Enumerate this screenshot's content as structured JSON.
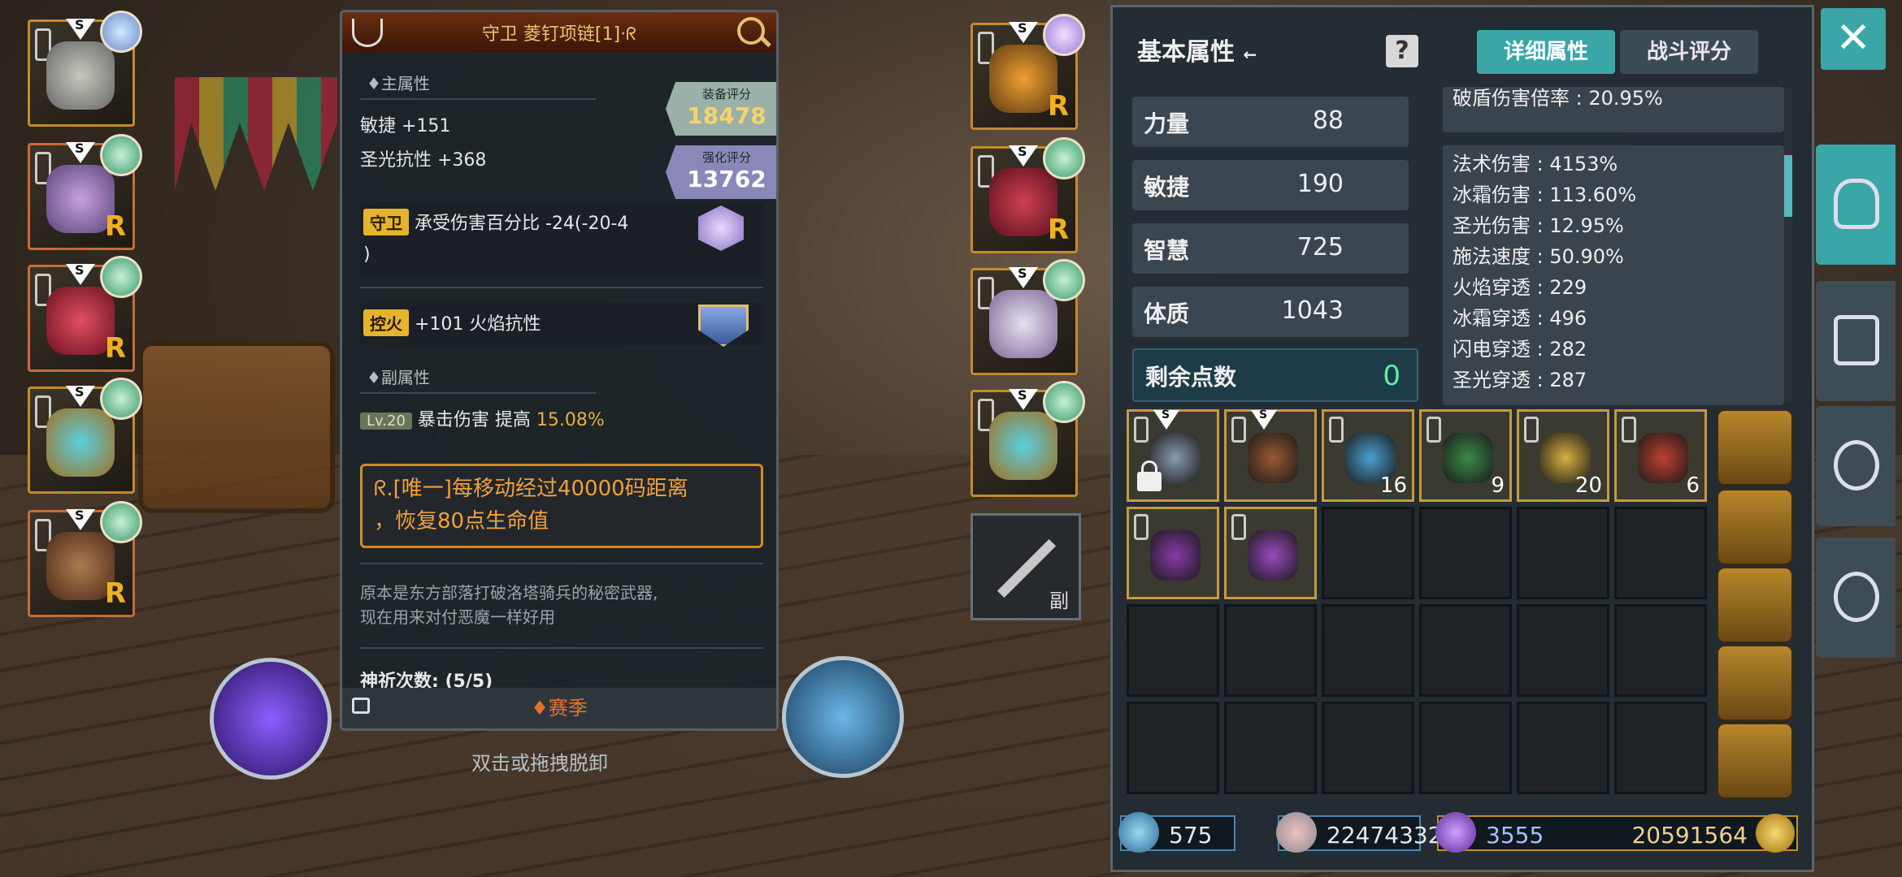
{
  "left_equipment": [
    {
      "name": "helmet",
      "rarity": "S"
    },
    {
      "name": "armor",
      "rarity": "S",
      "mark": "R"
    },
    {
      "name": "legs",
      "rarity": "S",
      "mark": "R"
    },
    {
      "name": "ring",
      "rarity": "S"
    },
    {
      "name": "staff",
      "rarity": "S",
      "mark": "R"
    }
  ],
  "right_equipment": [
    {
      "name": "necklace",
      "rarity": "S",
      "mark": "R"
    },
    {
      "name": "gloves",
      "rarity": "S",
      "mark": "R"
    },
    {
      "name": "boots",
      "rarity": "S"
    },
    {
      "name": "ring-2",
      "rarity": "S"
    }
  ],
  "sub_weapon": {
    "label": "副"
  },
  "hint_text": "双击或拖拽脱卸",
  "detail": {
    "title": "守卫 菱钉项链[1]·ᖇ",
    "main_attr_label": "♦主属性",
    "main_stats": [
      "敏捷 +151",
      "圣光抗性 +368"
    ],
    "gear_score": {
      "label": "装备评分",
      "value": "18478"
    },
    "enhance_score": {
      "label": "强化评分",
      "value": "13762"
    },
    "affix1": {
      "tag": "守卫",
      "text": "承受伤害百分比 -24(-20-4",
      "text2": ")"
    },
    "affix2": {
      "tag": "控火",
      "text": "+101 火焰抗性"
    },
    "sub_attr_label": "♦副属性",
    "sub_stat": {
      "level": "Lv.20",
      "text": "暴击伤害 提高",
      "value": "15.08%"
    },
    "unique_line1": "ᖇ.[唯一]每移动经过40000码距离",
    "unique_line2": "，恢复80点生命值",
    "flavor_line1": "原本是东方部落打破洛塔骑兵的秘密武器,",
    "flavor_line2": "现在用来对付恶魔一样好用",
    "prayer": "神祈次数: (5/5)",
    "season": "♦赛季"
  },
  "stats": {
    "title": "基本属性",
    "title_arrow": "←",
    "help": "?",
    "tabs": [
      "详细属性",
      "战斗评分"
    ],
    "base": [
      {
        "name": "力量",
        "value": "88"
      },
      {
        "name": "敏捷",
        "value": "190"
      },
      {
        "name": "智慧",
        "value": "725"
      },
      {
        "name": "体质",
        "value": "1043"
      }
    ],
    "points": {
      "name": "剩余点数",
      "value": "0"
    },
    "top_detail": "破盾伤害倍率 : 20.95%",
    "details": [
      "法术伤害 : 4153%",
      "冰霜伤害 : 113.60%",
      "圣光伤害 : 12.95%",
      "施法速度 : 50.90%",
      "火焰穿透 : 229",
      "冰霜穿透 : 496",
      "闪电穿透 : 282",
      "圣光穿透 : 287"
    ]
  },
  "inventory": [
    {
      "rarity": "S",
      "locked": true,
      "color": "#8a9ab0"
    },
    {
      "rarity": "S",
      "color": "#9a5a30"
    },
    {
      "count": "16",
      "color": "#4aa0d0"
    },
    {
      "count": "9",
      "color": "#3a8a4a"
    },
    {
      "count": "20",
      "color": "#d8b040"
    },
    {
      "count": "6",
      "color": "#c04030"
    },
    {
      "color": "#8a3aa8"
    },
    {
      "color": "#9a4ac0"
    }
  ],
  "currency": {
    "wand": "575",
    "heart": "22474332",
    "crystal": "3555",
    "gold": "20591564"
  },
  "colors": {
    "accent": "#3aa6a8",
    "gold": "#f7d36a",
    "orange": "#e87030"
  },
  "close": "✕",
  "nav": [
    "helmet-icon",
    "gloves-icon",
    "target-icon",
    "settings-icon"
  ]
}
